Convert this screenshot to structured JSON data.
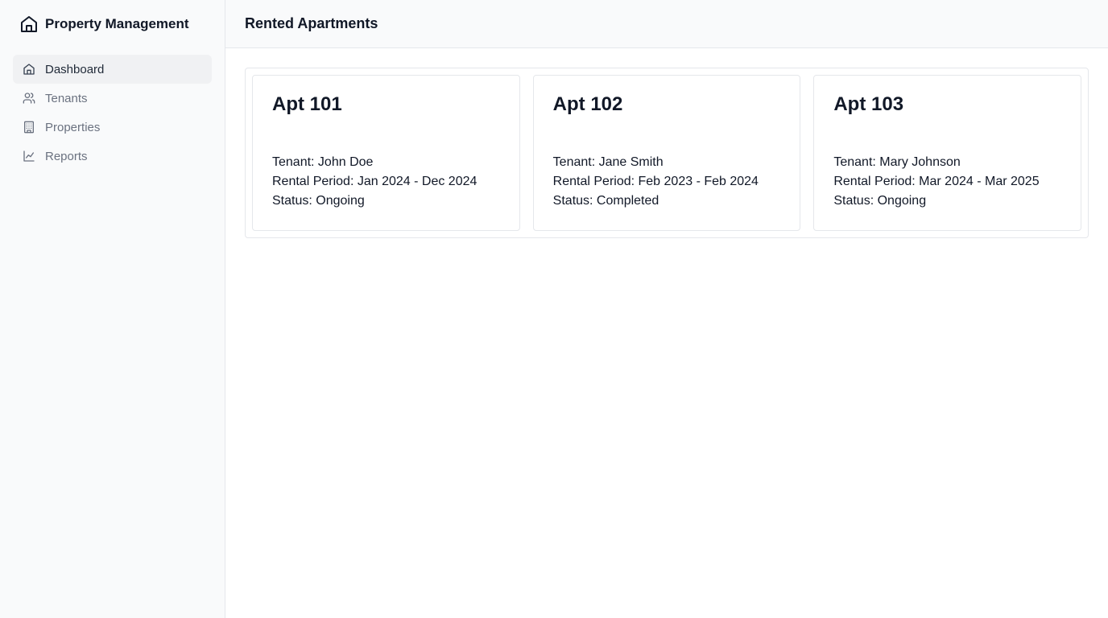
{
  "brand": {
    "title": "Property Management"
  },
  "sidebar": {
    "items": [
      {
        "label": "Dashboard",
        "icon": "home-icon",
        "active": true
      },
      {
        "label": "Tenants",
        "icon": "users-icon",
        "active": false
      },
      {
        "label": "Properties",
        "icon": "building-icon",
        "active": false
      },
      {
        "label": "Reports",
        "icon": "line-chart-icon",
        "active": false
      }
    ]
  },
  "header": {
    "title": "Rented Apartments"
  },
  "apartments": [
    {
      "name": "Apt 101",
      "tenant": "Tenant: John Doe",
      "period": "Rental Period: Jan 2024 - Dec 2024",
      "status": "Status: Ongoing"
    },
    {
      "name": "Apt 102",
      "tenant": "Tenant: Jane Smith",
      "period": "Rental Period: Feb 2023 - Feb 2024",
      "status": "Status: Completed"
    },
    {
      "name": "Apt 103",
      "tenant": "Tenant: Mary Johnson",
      "period": "Rental Period: Mar 2024 - Mar 2025",
      "status": "Status: Ongoing"
    }
  ],
  "colors": {
    "sidebar_bg": "#f9fafb",
    "active_bg": "#f0f1f3",
    "border": "#e5e7eb",
    "text_muted": "#6b7280",
    "text_main": "#111827"
  }
}
